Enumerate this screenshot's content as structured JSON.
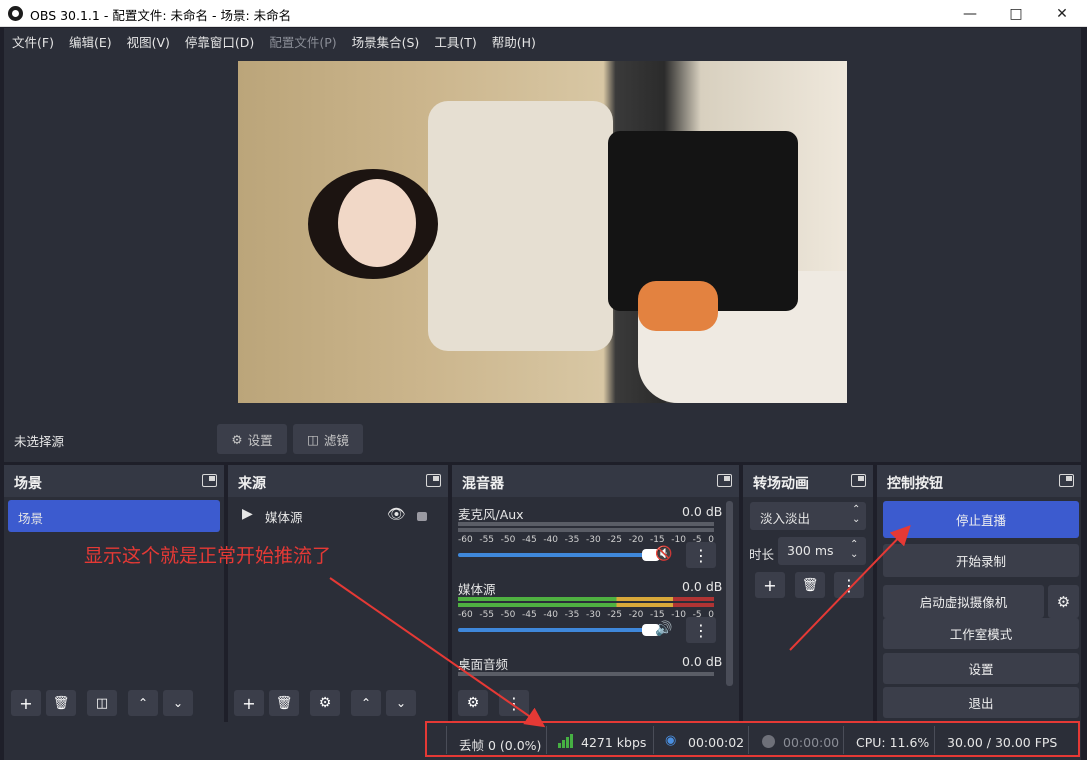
{
  "window": {
    "title": "OBS 30.1.1 - 配置文件: 未命名 - 场景: 未命名"
  },
  "menu": [
    {
      "label": "文件(F)",
      "disabled": false
    },
    {
      "label": "编辑(E)",
      "disabled": false
    },
    {
      "label": "视图(V)",
      "disabled": false
    },
    {
      "label": "停靠窗口(D)",
      "disabled": false
    },
    {
      "label": "配置文件(P)",
      "disabled": true
    },
    {
      "label": "场景集合(S)",
      "disabled": false
    },
    {
      "label": "工具(T)",
      "disabled": false
    },
    {
      "label": "帮助(H)",
      "disabled": false
    }
  ],
  "source_toolbar": {
    "no_source": "未选择源",
    "settings": "设置",
    "filters": "滤镜"
  },
  "docks": {
    "scenes": {
      "title": "场景",
      "items": [
        "场景"
      ]
    },
    "sources": {
      "title": "来源",
      "items": [
        "媒体源"
      ]
    },
    "mixer": {
      "title": "混音器",
      "channels": [
        {
          "name": "麦克风/Aux",
          "db": "0.0 dB",
          "muted": true
        },
        {
          "name": "媒体源",
          "db": "0.0 dB",
          "muted": false
        },
        {
          "name": "桌面音频",
          "db": "0.0 dB",
          "muted": false
        }
      ],
      "ticks": [
        "-60",
        "-55",
        "-50",
        "-45",
        "-40",
        "-35",
        "-30",
        "-25",
        "-20",
        "-15",
        "-10",
        "-5",
        "0"
      ]
    },
    "transitions": {
      "title": "转场动画",
      "selected": "淡入淡出",
      "duration_label": "时长",
      "duration": "300 ms"
    },
    "controls": {
      "title": "控制按钮",
      "stop_stream": "停止直播",
      "start_record": "开始录制",
      "virtual_cam": "启动虚拟摄像机",
      "studio_mode": "工作室模式",
      "settings": "设置",
      "exit": "退出"
    }
  },
  "status": {
    "dropped_frames": "丢帧 0 (0.0%)",
    "bitrate": "4271 kbps",
    "stream_time": "00:00:02",
    "record_time": "00:00:00",
    "cpu": "CPU: 11.6%",
    "fps": "30.00 / 30.00 FPS"
  },
  "annotation": "显示这个就是正常开始推流了",
  "colors": {
    "accent": "#3c5bcf",
    "annotation": "#e53935",
    "panel": "#2b2e38",
    "header": "#343844"
  }
}
